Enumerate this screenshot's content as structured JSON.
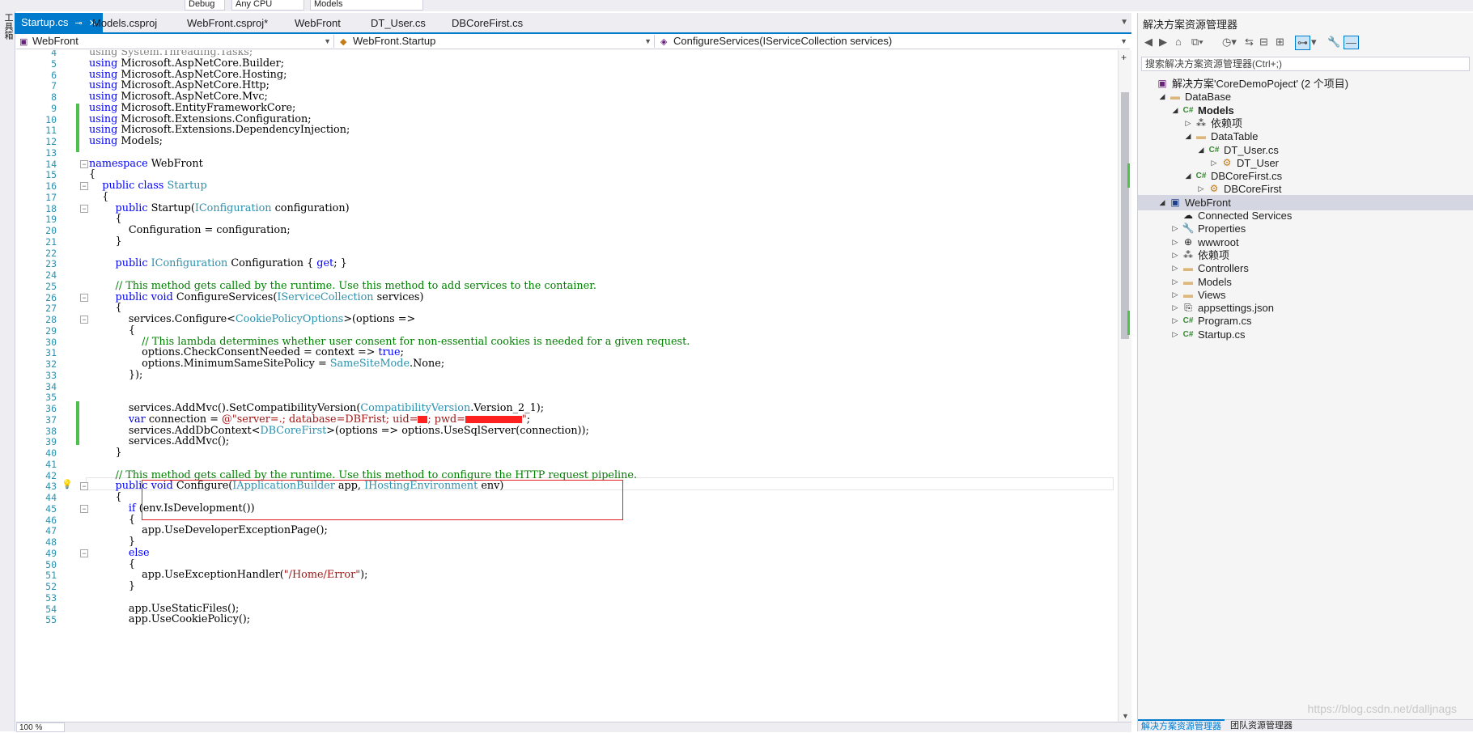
{
  "leftstrip": {
    "label": "工具箱"
  },
  "toolbar": {
    "config": "Debug",
    "platform": "Any CPU",
    "project": "Models"
  },
  "tabs": [
    {
      "label": "Startup.cs",
      "active": true
    },
    {
      "label": "Models.csproj"
    },
    {
      "label": "WebFront.csproj*"
    },
    {
      "label": "WebFront"
    },
    {
      "label": "DT_User.cs"
    },
    {
      "label": "DBCoreFirst.cs"
    }
  ],
  "navbar": {
    "project": "WebFront",
    "type": "WebFront.Startup",
    "member": "ConfigureServices(IServiceCollection services)"
  },
  "code_lines": [
    {
      "n": "4",
      "html": "<span class='gray'>using System.Threading.Tasks;</span>"
    },
    {
      "n": "5",
      "html": "<span class='kw'>using</span> Microsoft.AspNetCore.Builder;"
    },
    {
      "n": "6",
      "html": "<span class='kw'>using</span> Microsoft.AspNetCore.Hosting;"
    },
    {
      "n": "7",
      "html": "<span class='kw'>using</span> Microsoft.AspNetCore.Http;"
    },
    {
      "n": "8",
      "html": "<span class='kw'>using</span> Microsoft.AspNetCore.Mvc;"
    },
    {
      "n": "9",
      "html": "<span class='kw'>using</span> Microsoft.EntityFrameworkCore;"
    },
    {
      "n": "10",
      "html": "<span class='kw'>using</span> Microsoft.Extensions.Configuration;"
    },
    {
      "n": "11",
      "html": "<span class='kw'>using</span> Microsoft.Extensions.DependencyInjection;"
    },
    {
      "n": "12",
      "html": "<span class='kw'>using</span> Models;"
    },
    {
      "n": "13",
      "html": ""
    },
    {
      "n": "14",
      "html": "<span class='kw'>namespace</span> WebFront",
      "fold": true
    },
    {
      "n": "15",
      "html": "{"
    },
    {
      "n": "16",
      "html": "    <span class='kw'>public class</span> <span class='ty'>Startup</span>",
      "fold": true
    },
    {
      "n": "17",
      "html": "    {"
    },
    {
      "n": "18",
      "html": "        <span class='kw'>public</span> Startup(<span class='ty'>IConfiguration</span> configuration)",
      "fold": true
    },
    {
      "n": "19",
      "html": "        {"
    },
    {
      "n": "20",
      "html": "            Configuration = configuration;"
    },
    {
      "n": "21",
      "html": "        }"
    },
    {
      "n": "22",
      "html": ""
    },
    {
      "n": "23",
      "html": "        <span class='kw'>public</span> <span class='ty'>IConfiguration</span> Configuration { <span class='kw'>get</span>; }"
    },
    {
      "n": "24",
      "html": ""
    },
    {
      "n": "25",
      "html": "        <span class='cm'>// This method gets called by the runtime. Use this method to add services to the container.</span>"
    },
    {
      "n": "26",
      "html": "        <span class='kw'>public void</span> ConfigureServices(<span class='ty'>IServiceCollection</span> services)",
      "fold": true
    },
    {
      "n": "27",
      "html": "        {"
    },
    {
      "n": "28",
      "html": "            services.Configure&lt;<span class='ty'>CookiePolicyOptions</span>&gt;(options =&gt;",
      "fold": true
    },
    {
      "n": "29",
      "html": "            {"
    },
    {
      "n": "30",
      "html": "                <span class='cm'>// This lambda determines whether user consent for non-essential cookies is needed for a given request.</span>"
    },
    {
      "n": "31",
      "html": "                options.CheckConsentNeeded = context =&gt; <span class='kw'>true</span>;"
    },
    {
      "n": "32",
      "html": "                options.MinimumSameSitePolicy = <span class='ty'>SameSiteMode</span>.None;"
    },
    {
      "n": "33",
      "html": "            });"
    },
    {
      "n": "34",
      "html": ""
    },
    {
      "n": "35",
      "html": ""
    },
    {
      "n": "36",
      "html": "            services.AddMvc().SetCompatibilityVersion(<span class='ty'>CompatibilityVersion</span>.Version_2_1);"
    },
    {
      "n": "37",
      "html": "            <span class='kw'>var</span> connection = <span class='st'>@\"server=.; database=DBFrist; uid=<span class='redact' style='width:12px'></span>; pwd=<span class='redact' style='width:70px'></span>\"</span>;"
    },
    {
      "n": "38",
      "html": "            services.AddDbContext&lt;<span class='ty'>DBCoreFirst</span>&gt;(options =&gt; options.UseSqlServer(connection));"
    },
    {
      "n": "39",
      "html": "            services.AddMvc();"
    },
    {
      "n": "40",
      "html": "        }"
    },
    {
      "n": "41",
      "html": ""
    },
    {
      "n": "42",
      "html": "        <span class='cm'>// This method gets called by the runtime. Use this method to configure the HTTP request pipeline.</span>"
    },
    {
      "n": "43",
      "html": "        <span class='kw'>public void</span> Configure(<span class='ty'>IApplicationBuilder</span> app, <span class='ty'>IHostingEnvironment</span> env)",
      "fold": true
    },
    {
      "n": "44",
      "html": "        {"
    },
    {
      "n": "45",
      "html": "            <span class='kw'>if</span> (env.IsDevelopment())",
      "fold": true
    },
    {
      "n": "46",
      "html": "            {"
    },
    {
      "n": "47",
      "html": "                app.UseDeveloperExceptionPage();"
    },
    {
      "n": "48",
      "html": "            }"
    },
    {
      "n": "49",
      "html": "            <span class='kw'>else</span>",
      "fold": true
    },
    {
      "n": "50",
      "html": "            {"
    },
    {
      "n": "51",
      "html": "                app.UseExceptionHandler(<span class='st'>\"/Home/Error\"</span>);"
    },
    {
      "n": "52",
      "html": "            }"
    },
    {
      "n": "53",
      "html": ""
    },
    {
      "n": "54",
      "html": "            app.UseStaticFiles();"
    },
    {
      "n": "55",
      "html": "            app.UseCookiePolicy();"
    }
  ],
  "zoom": "100 %",
  "solution_explorer": {
    "title": "解决方案资源管理器",
    "search_placeholder": "搜索解决方案资源管理器(Ctrl+;)",
    "tree": [
      {
        "label": "解决方案'CoreDemoPoject' (2 个项目)",
        "depth": 0,
        "icon": "sln",
        "exp": ""
      },
      {
        "label": "DataBase",
        "depth": 1,
        "icon": "folder",
        "exp": "◢"
      },
      {
        "label": "Models",
        "depth": 2,
        "icon": "proj",
        "exp": "◢",
        "bold": true
      },
      {
        "label": "依赖项",
        "depth": 3,
        "icon": "deps",
        "exp": "▷"
      },
      {
        "label": "DataTable",
        "depth": 3,
        "icon": "folder",
        "exp": "◢"
      },
      {
        "label": "DT_User.cs",
        "depth": 4,
        "icon": "cs",
        "exp": "◢"
      },
      {
        "label": "DT_User",
        "depth": 5,
        "icon": "class",
        "exp": "▷"
      },
      {
        "label": "DBCoreFirst.cs",
        "depth": 3,
        "icon": "cs",
        "exp": "◢"
      },
      {
        "label": "DBCoreFirst",
        "depth": 4,
        "icon": "class",
        "exp": "▷"
      },
      {
        "label": "WebFront",
        "depth": 1,
        "icon": "web",
        "exp": "◢",
        "wf": true
      },
      {
        "label": "Connected Services",
        "depth": 2,
        "icon": "connected",
        "exp": ""
      },
      {
        "label": "Properties",
        "depth": 2,
        "icon": "wrench",
        "exp": "▷"
      },
      {
        "label": "wwwroot",
        "depth": 2,
        "icon": "globe",
        "exp": "▷"
      },
      {
        "label": "依赖项",
        "depth": 2,
        "icon": "deps",
        "exp": "▷"
      },
      {
        "label": "Controllers",
        "depth": 2,
        "icon": "folder",
        "exp": "▷"
      },
      {
        "label": "Models",
        "depth": 2,
        "icon": "folder",
        "exp": "▷"
      },
      {
        "label": "Views",
        "depth": 2,
        "icon": "folder",
        "exp": "▷"
      },
      {
        "label": "appsettings.json",
        "depth": 2,
        "icon": "json",
        "exp": "▷"
      },
      {
        "label": "Program.cs",
        "depth": 2,
        "icon": "cs",
        "exp": "▷"
      },
      {
        "label": "Startup.cs",
        "depth": 2,
        "icon": "cs",
        "exp": "▷"
      }
    ],
    "bottom_tabs": [
      "解决方案资源管理器",
      "团队资源管理器"
    ]
  },
  "watermark": "https://blog.csdn.net/dalljnags",
  "colors": {
    "accent": "#007acc",
    "keyword": "#0000ff",
    "type": "#2b91af",
    "comment": "#008000",
    "string": "#a31515",
    "highlight_box": "#e02020"
  }
}
